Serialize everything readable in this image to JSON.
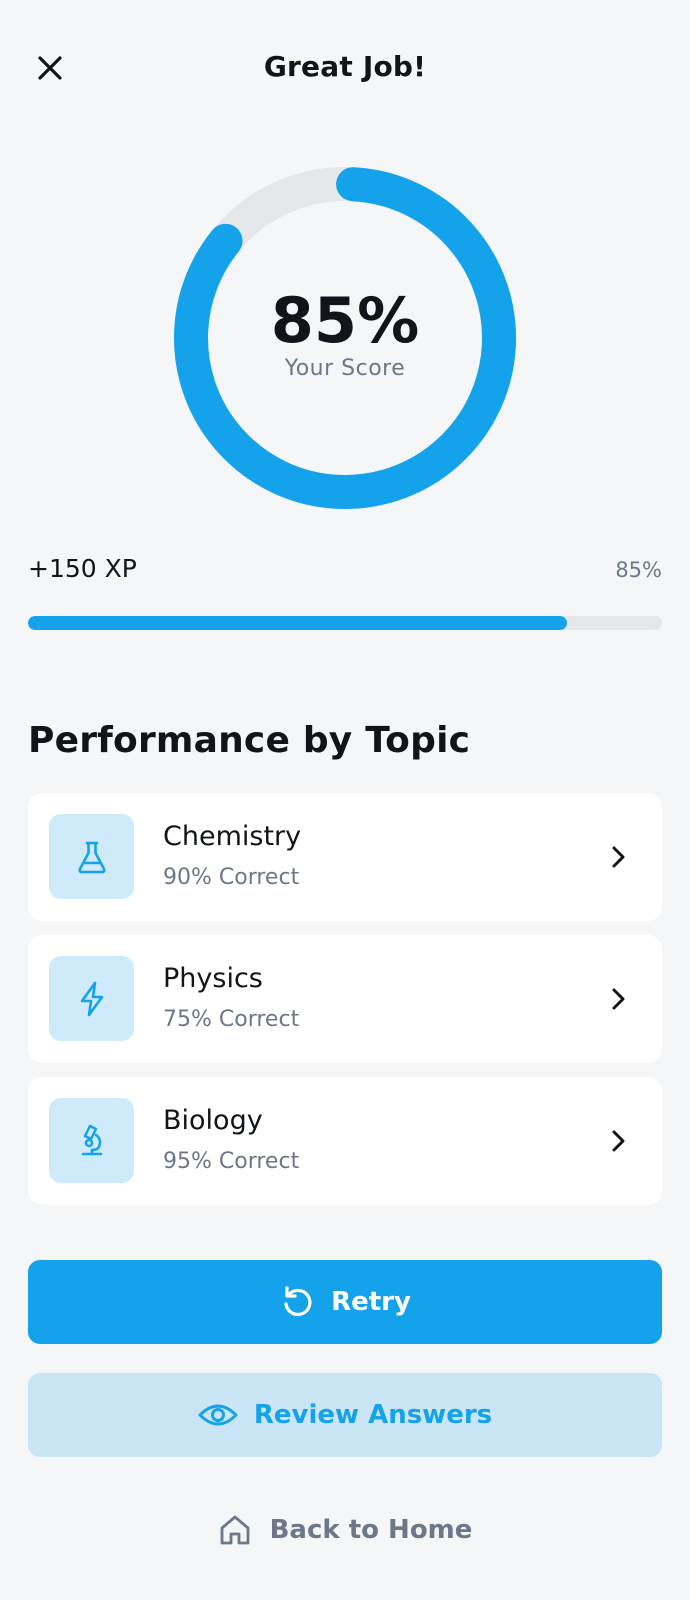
{
  "header": {
    "title": "Great Job!",
    "close_icon": "close-icon"
  },
  "score": {
    "value": "85%",
    "label": "Your Score",
    "fraction": 0.85,
    "ring_color": "#14a3ea",
    "track_color": "#e5e7ea"
  },
  "xp": {
    "label": "+150 XP",
    "percent_text": "85%",
    "progress_fraction": 0.85
  },
  "performance": {
    "title": "Performance by Topic",
    "topics": [
      {
        "name": "Chemistry",
        "result": "90% Correct",
        "icon": "flask-icon"
      },
      {
        "name": "Physics",
        "result": "75% Correct",
        "icon": "lightning-icon"
      },
      {
        "name": "Biology",
        "result": "95% Correct",
        "icon": "microscope-icon"
      }
    ]
  },
  "actions": {
    "retry_label": "Retry",
    "retry_icon": "retry-icon",
    "review_label": "Review Answers",
    "review_icon": "eye-icon",
    "home_label": "Back to Home",
    "home_icon": "home-icon"
  },
  "colors": {
    "accent": "#14a3ea",
    "accent_light": "#c9e5f6",
    "muted_text": "#6c7788",
    "background": "#f5f6f8"
  }
}
